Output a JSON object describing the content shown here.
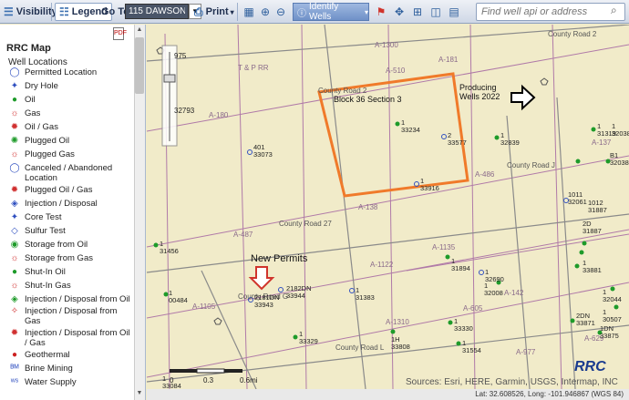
{
  "toolbar": {
    "visibility": "Visibility",
    "legend": "Legend",
    "goto_label": "Go To:",
    "goto_value": "115 DAWSON",
    "print": "Print",
    "identify": "Identify Wells",
    "search_placeholder": "Find well api or address"
  },
  "panel": {
    "title": "RRC Map",
    "subtitle": "Well Locations",
    "items": [
      {
        "label": "Permitted Location",
        "sym": "◯",
        "color": "#3050c0"
      },
      {
        "label": "Dry Hole",
        "sym": "✦",
        "color": "#3050c0"
      },
      {
        "label": "Oil",
        "sym": "●",
        "color": "#1e9b2a"
      },
      {
        "label": "Gas",
        "sym": "☼",
        "color": "#d03030"
      },
      {
        "label": "Oil / Gas",
        "sym": "✹",
        "color": "#d03030"
      },
      {
        "label": "Plugged Oil",
        "sym": "✺",
        "color": "#1e9b2a"
      },
      {
        "label": "Plugged Gas",
        "sym": "☼",
        "color": "#d03030"
      },
      {
        "label": "Canceled / Abandoned Location",
        "sym": "◯",
        "color": "#3050c0"
      },
      {
        "label": "Plugged Oil / Gas",
        "sym": "✹",
        "color": "#d03030"
      },
      {
        "label": "Injection / Disposal",
        "sym": "◈",
        "color": "#3050c0"
      },
      {
        "label": "Core Test",
        "sym": "✦",
        "color": "#3050c0"
      },
      {
        "label": "Sulfur Test",
        "sym": "◇",
        "color": "#3050c0"
      },
      {
        "label": "Storage from Oil",
        "sym": "◉",
        "color": "#1e9b2a"
      },
      {
        "label": "Storage from Gas",
        "sym": "☼",
        "color": "#d03030"
      },
      {
        "label": "Shut-In Oil",
        "sym": "●",
        "color": "#1e9b2a"
      },
      {
        "label": "Shut-In Gas",
        "sym": "☼",
        "color": "#d03030"
      },
      {
        "label": "Injection / Disposal from Oil",
        "sym": "◈",
        "color": "#1e9b2a"
      },
      {
        "label": "Injection / Disposal from Gas",
        "sym": "✧",
        "color": "#d03030"
      },
      {
        "label": "Injection / Disposal from Oil / Gas",
        "sym": "✹",
        "color": "#d03030"
      },
      {
        "label": "Geothermal",
        "sym": "●",
        "color": "#cc2222"
      },
      {
        "label": "Brine Mining",
        "sym": "ᴮᴹ",
        "color": "#3050c0"
      },
      {
        "label": "Water Supply",
        "sym": "ʷˢ",
        "color": "#3050c0"
      }
    ]
  },
  "map": {
    "annotations": {
      "block": "Block 36 Section 3",
      "producing": "Producing Wells 2022",
      "new_permits": "New Permits"
    },
    "labels": {
      "tp_rr": "T & P RR",
      "county_road_j": "County Road J",
      "county_road_g": "County Road G",
      "county_road_27": "County Road 27",
      "county_road_2": "County Road 2",
      "county_road_l": "County Road L",
      "county_road_top": "County Road 2",
      "a1300": "A-1300",
      "a510": "A-510",
      "a181": "A-181",
      "a180": "A-180",
      "a137": "A-137",
      "a487": "A-487",
      "a138": "A-138",
      "a486": "A-486",
      "a1135": "A-1135",
      "a1122": "A-1122",
      "a142": "A-142",
      "a605": "A-605",
      "a1105": "A-1105",
      "a1310": "A-1310",
      "a977": "A-977",
      "a629": "A-629",
      "n975": "975",
      "n32793": "32793"
    },
    "wells": [
      {
        "n": "1",
        "id": "33234"
      },
      {
        "n": "2",
        "id": "33577"
      },
      {
        "n": "1",
        "id": "33916"
      },
      {
        "n": "1",
        "id": "32839"
      },
      {
        "n": "1",
        "id": "31319"
      },
      {
        "n": "1",
        "id": "32038"
      },
      {
        "n": "401",
        "id": "33073"
      },
      {
        "n": "1011",
        "id": "32061"
      },
      {
        "n": "1",
        "id": "31456"
      },
      {
        "n": "2D",
        "id": "31887"
      },
      {
        "n": "1012",
        "id": "31887"
      },
      {
        "n": "1",
        "id": "31894"
      },
      {
        "n": "1",
        "id": "32690"
      },
      {
        "n": "1",
        "id": "32008"
      },
      {
        "n": "1",
        "id": "31383"
      },
      {
        "n": "2181DN",
        "id": "33943"
      },
      {
        "n": "2182DN",
        "id": "33944"
      },
      {
        "n": "1",
        "id": "00484"
      },
      {
        "n": "1",
        "id": "33330"
      },
      {
        "n": "1",
        "id": "33329"
      },
      {
        "n": "1H",
        "id": "33808"
      },
      {
        "n": "1",
        "id": "31554"
      },
      {
        "n": "2DN",
        "id": "33871"
      },
      {
        "n": "1DN",
        "id": "33875"
      },
      {
        "n": "1",
        "id": "32044"
      },
      {
        "n": "1",
        "id": "30507"
      },
      {
        "n": "B1",
        "id": "32038"
      },
      {
        "n": "1",
        "id": "33881"
      },
      {
        "n": "1",
        "id": "33084"
      }
    ],
    "scale_labels": [
      "0",
      "0.3",
      "0.6mi"
    ],
    "attribution": "Sources: Esri, HERE, Garmin, USGS, Intermap, INC",
    "status": "Lat: 32.608526, Long: -101.946867 (WGS 84)",
    "logo": "RRC"
  },
  "colors": {
    "map_bg": "#f1ebc9",
    "survey_line": "#b07aa8",
    "road": "#8a8a8a",
    "highlight": "#f07a2a",
    "permit_arrow": "#d0342c"
  }
}
